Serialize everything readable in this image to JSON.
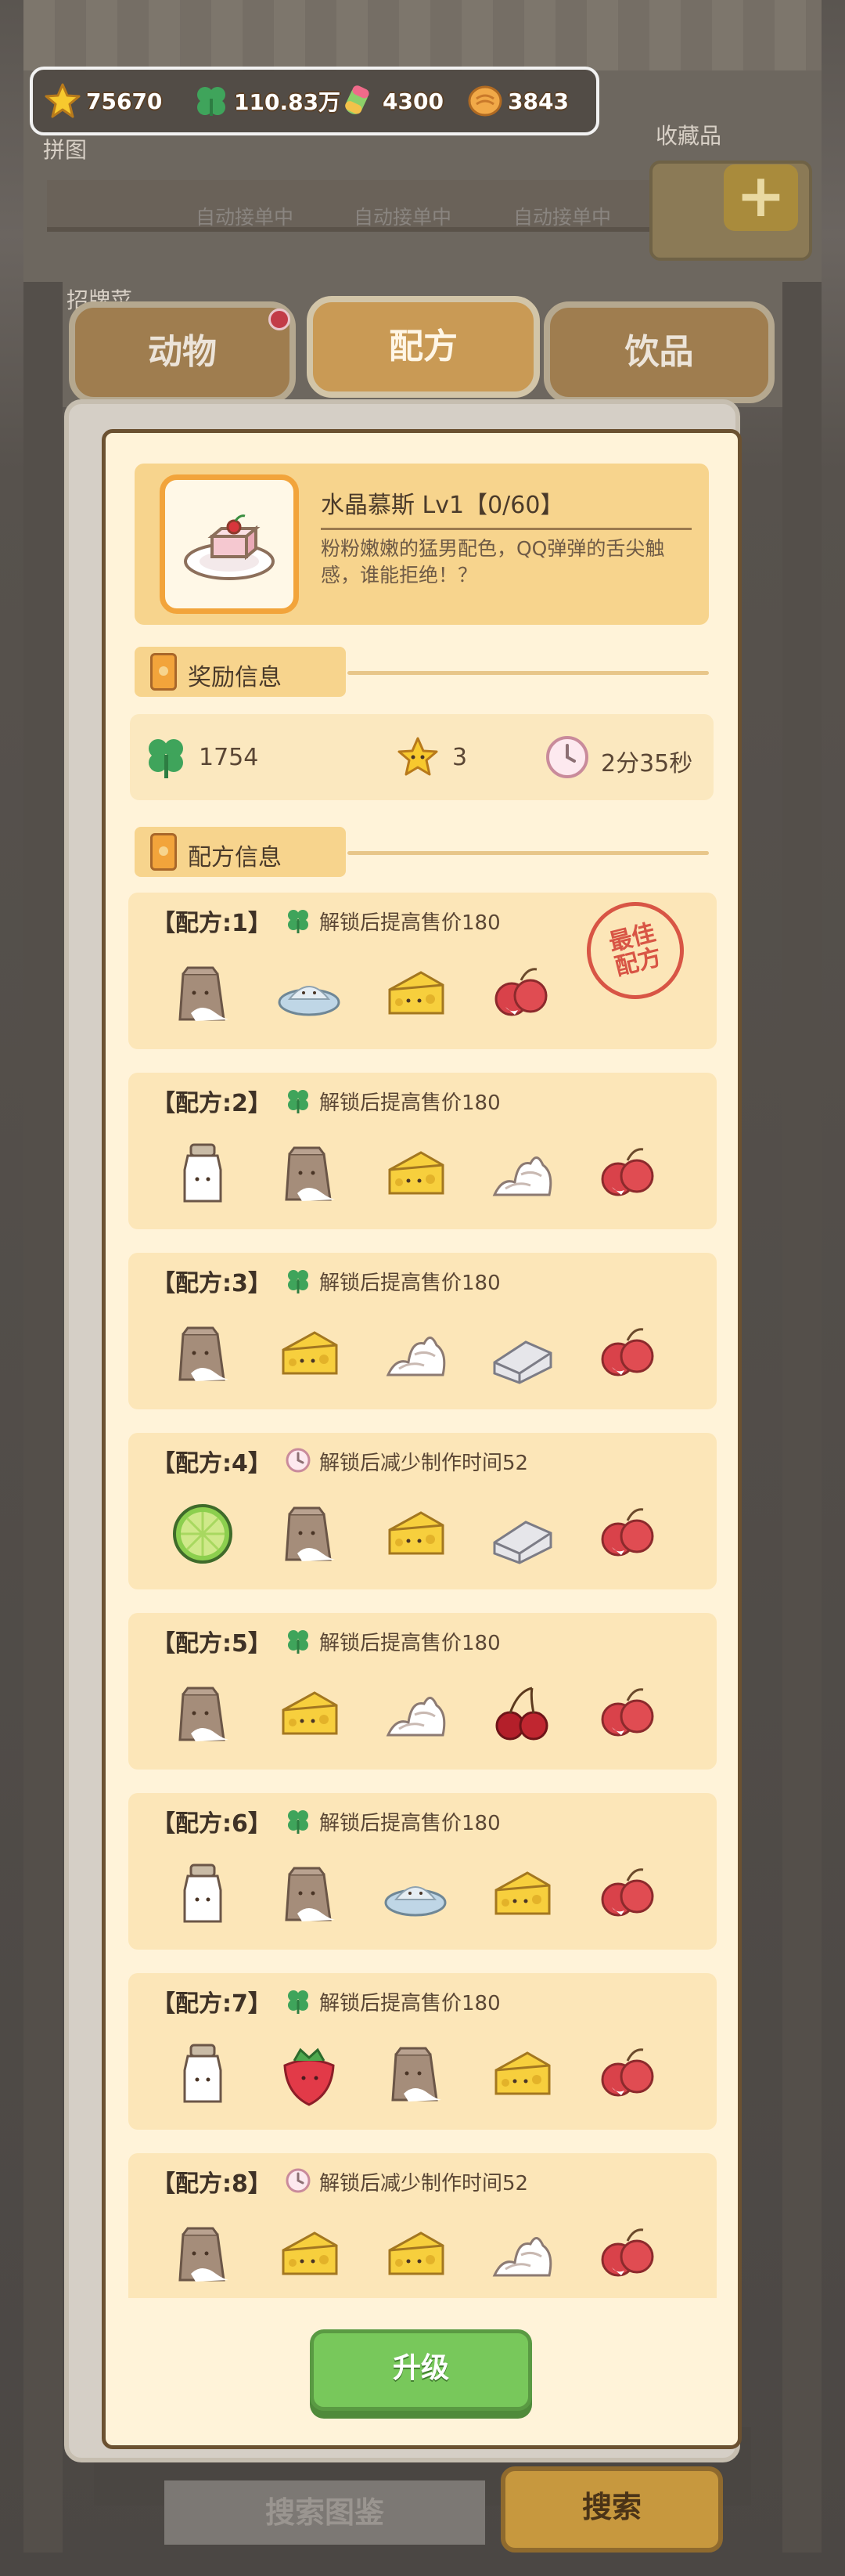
{
  "resources": [
    {
      "icon": "star-icon",
      "value": "75670"
    },
    {
      "icon": "clover-icon",
      "value": "110.83万"
    },
    {
      "icon": "candy-icon",
      "value": "4300"
    },
    {
      "icon": "cookie-coin-icon",
      "value": "3843"
    }
  ],
  "background": {
    "auto_orders": [
      "自动接单中",
      "自动接单中",
      "自动接单中"
    ],
    "left_label_1": "拼图",
    "left_label_2": "招牌菜",
    "collection_label": "收藏品"
  },
  "tabs": [
    {
      "label": "动物",
      "active": false
    },
    {
      "label": "配方",
      "active": true
    },
    {
      "label": "饮品",
      "active": false
    }
  ],
  "dish": {
    "name": "水晶慕斯 Lv1【0/60】",
    "description": "粉粉嫩嫩的猛男配色，QQ弹弹的舌尖触感，谁能拒绝！？"
  },
  "reward_section": {
    "title": "奖励信息",
    "clover": "1754",
    "stars": "3",
    "time": "2分35秒"
  },
  "recipe_section": {
    "title": "配方信息"
  },
  "best_stamp": "最佳配方",
  "recipes": [
    {
      "title": "【配方:1】",
      "bonus_icon": "clover-icon",
      "bonus": "解锁后提高售价180",
      "ingredients": [
        "flour-sack-icon",
        "sugar-plate-icon",
        "cheese-icon",
        "lychee-icon"
      ]
    },
    {
      "title": "【配方:2】",
      "bonus_icon": "clover-icon",
      "bonus": "解锁后提高售价180",
      "ingredients": [
        "milk-bottle-icon",
        "flour-sack-icon",
        "cheese-icon",
        "whipped-cream-icon",
        "lychee-icon"
      ]
    },
    {
      "title": "【配方:3】",
      "bonus_icon": "clover-icon",
      "bonus": "解锁后提高售价180",
      "ingredients": [
        "flour-sack-icon",
        "cheese-icon",
        "whipped-cream-icon",
        "butter-icon",
        "lychee-icon"
      ]
    },
    {
      "title": "【配方:4】",
      "bonus_icon": "clock-icon",
      "bonus": "解锁后减少制作时间52",
      "ingredients": [
        "lime-icon",
        "flour-sack-icon",
        "cheese-icon",
        "butter-icon",
        "lychee-icon"
      ]
    },
    {
      "title": "【配方:5】",
      "bonus_icon": "clover-icon",
      "bonus": "解锁后提高售价180",
      "ingredients": [
        "flour-sack-icon",
        "cheese-icon",
        "whipped-cream-icon",
        "cherry-icon",
        "lychee-icon"
      ]
    },
    {
      "title": "【配方:6】",
      "bonus_icon": "clover-icon",
      "bonus": "解锁后提高售价180",
      "ingredients": [
        "milk-bottle-icon",
        "flour-sack-icon",
        "sugar-plate-icon",
        "cheese-icon",
        "lychee-icon"
      ]
    },
    {
      "title": "【配方:7】",
      "bonus_icon": "clover-icon",
      "bonus": "解锁后提高售价180",
      "ingredients": [
        "milk-bottle-icon",
        "strawberry-icon",
        "flour-sack-icon",
        "cheese-icon",
        "lychee-icon"
      ]
    },
    {
      "title": "【配方:8】",
      "bonus_icon": "clock-icon",
      "bonus": "解锁后减少制作时间52",
      "ingredients": [
        "flour-sack-icon",
        "cheese-icon",
        "cheese-icon",
        "whipped-cream-icon",
        "lychee-icon"
      ]
    }
  ],
  "buttons": {
    "upgrade": "升级",
    "search_catalog": "搜索图鉴",
    "search": "搜索"
  }
}
